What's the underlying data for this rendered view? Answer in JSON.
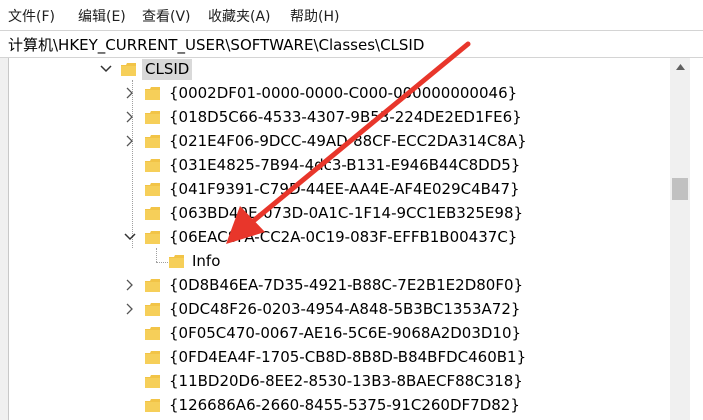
{
  "menu": {
    "file": "文件(F)",
    "edit": "编辑(E)",
    "view": "查看(V)",
    "favorites": "收藏夹(A)",
    "help": "帮助(H)"
  },
  "address": "计算机\\HKEY_CURRENT_USER\\SOFTWARE\\Classes\\CLSID",
  "tree": {
    "root": "CLSID",
    "items": [
      "{0002DF01-0000-0000-C000-000000000046}",
      "{018D5C66-4533-4307-9B53-224DE2ED1FE6}",
      "{021E4F06-9DCC-49AD-88CF-ECC2DA314C8A}",
      "{031E4825-7B94-4dc3-B131-E946B44C8DD5}",
      "{041F9391-C79D-44EE-AA4E-AF4E029C4B47}",
      "{063BD40E-073D-0A1C-1F14-9CC1EB325E98}",
      "{06EAC8FA-CC2A-0C19-083F-EFFB1B00437C}",
      "{0D8B46EA-7D35-4921-B88C-7E2B1E2D80F0}",
      "{0DC48F26-0203-4954-A848-5B3BC1353A72}",
      "{0F05C470-0067-AE16-5C6E-9068A2D03D10}",
      "{0FD4EA4F-1705-CB8D-8B8D-B84BFDC460B1}",
      "{11BD20D6-8EE2-8530-13B3-8BAECF88C318}",
      "{126686A6-2660-8455-5375-91C260DF7D82}"
    ],
    "expanded_child": "Info"
  },
  "colors": {
    "folder": "#f2c447",
    "folder_dark": "#dba520",
    "arrow": "#e8362b"
  }
}
